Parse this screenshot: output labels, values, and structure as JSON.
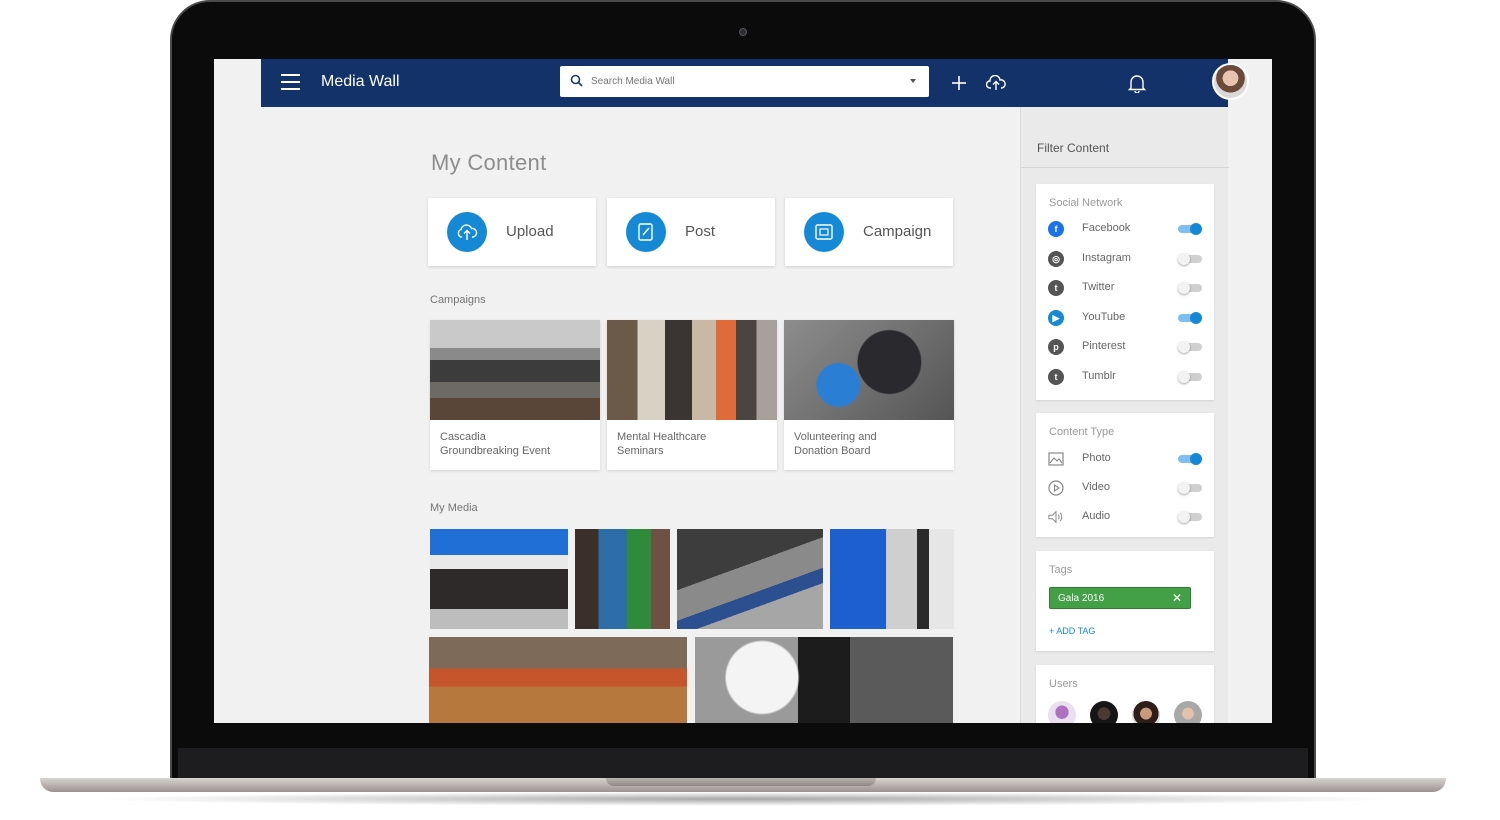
{
  "app": {
    "title": "Media Wall"
  },
  "search": {
    "placeholder": "Search Media Wall"
  },
  "main": {
    "heading": "My Content",
    "actions": [
      {
        "label": "Upload",
        "icon": "cloud-upload-icon"
      },
      {
        "label": "Post",
        "icon": "edit-note-icon"
      },
      {
        "label": "Campaign",
        "icon": "image-frame-icon"
      }
    ],
    "campaigns_label": "Campaigns",
    "campaigns": [
      {
        "caption": "Cascadia\nGroundbreaking Event"
      },
      {
        "caption": "Mental Healthcare\nSeminars"
      },
      {
        "caption": "Volunteering and\nDonation Board"
      }
    ],
    "media_label": "My Media"
  },
  "filter": {
    "title": "Filter Content",
    "social": {
      "title": "Social Network",
      "items": [
        {
          "label": "Facebook",
          "on": true,
          "color": "#1a73e8",
          "glyph": "f"
        },
        {
          "label": "Instagram",
          "on": false,
          "color": "#555555",
          "glyph": "◎"
        },
        {
          "label": "Twitter",
          "on": false,
          "color": "#555555",
          "glyph": "t"
        },
        {
          "label": "YouTube",
          "on": true,
          "color": "#1689d6",
          "glyph": "▶"
        },
        {
          "label": "Pinterest",
          "on": false,
          "color": "#555555",
          "glyph": "p"
        },
        {
          "label": "Tumblr",
          "on": false,
          "color": "#555555",
          "glyph": "t"
        }
      ]
    },
    "content_type": {
      "title": "Content Type",
      "items": [
        {
          "label": "Photo",
          "on": true
        },
        {
          "label": "Video",
          "on": false
        },
        {
          "label": "Audio",
          "on": false
        }
      ]
    },
    "tags": {
      "title": "Tags",
      "chip": "Gala 2016",
      "add": "+ ADD TAG"
    },
    "users": {
      "title": "Users"
    }
  },
  "colors": {
    "app_bar": "#13326a",
    "accent": "#1689d6",
    "tag": "#43a047"
  }
}
